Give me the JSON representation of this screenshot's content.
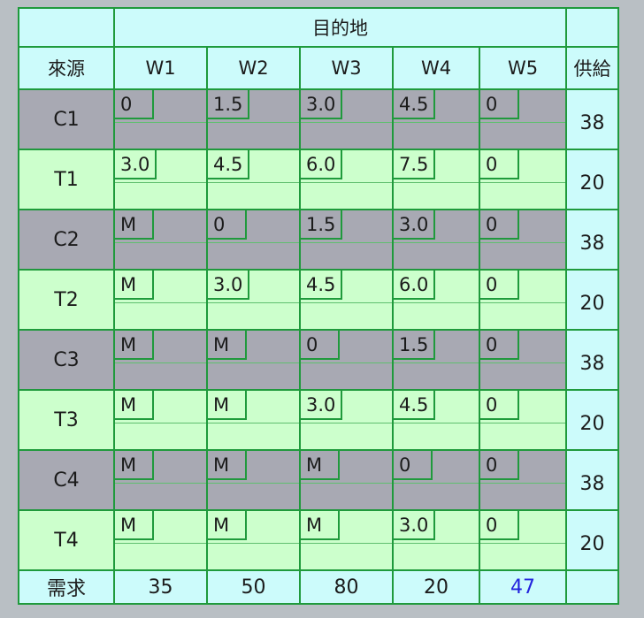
{
  "headers": {
    "destination": "目的地",
    "source": "來源",
    "supply": "供給",
    "demand": "需求",
    "columns": [
      "W1",
      "W2",
      "W3",
      "W4",
      "W5"
    ]
  },
  "rows": [
    {
      "label": "C1",
      "costs": [
        "0",
        "1.5",
        "3.0",
        "4.5",
        "0"
      ],
      "supply": "38",
      "shade": "gray"
    },
    {
      "label": "T1",
      "costs": [
        "3.0",
        "4.5",
        "6.0",
        "7.5",
        "0"
      ],
      "supply": "20",
      "shade": "green"
    },
    {
      "label": "C2",
      "costs": [
        "M",
        "0",
        "1.5",
        "3.0",
        "0"
      ],
      "supply": "38",
      "shade": "gray"
    },
    {
      "label": "T2",
      "costs": [
        "M",
        "3.0",
        "4.5",
        "6.0",
        "0"
      ],
      "supply": "20",
      "shade": "green"
    },
    {
      "label": "C3",
      "costs": [
        "M",
        "M",
        "0",
        "1.5",
        "0"
      ],
      "supply": "38",
      "shade": "gray"
    },
    {
      "label": "T3",
      "costs": [
        "M",
        "M",
        "3.0",
        "4.5",
        "0"
      ],
      "supply": "20",
      "shade": "green"
    },
    {
      "label": "C4",
      "costs": [
        "M",
        "M",
        "M",
        "0",
        "0"
      ],
      "supply": "38",
      "shade": "gray"
    },
    {
      "label": "T4",
      "costs": [
        "M",
        "M",
        "M",
        "3.0",
        "0"
      ],
      "supply": "20",
      "shade": "green"
    }
  ],
  "demand_values": [
    "35",
    "50",
    "80",
    "20",
    "47"
  ],
  "colors": {
    "grid": "#1f9a3c",
    "header_bg": "#ccfbfb",
    "gray_row": "#a8a9b3",
    "green_row": "#ccffcc",
    "highlight_demand": "#2222dd"
  }
}
